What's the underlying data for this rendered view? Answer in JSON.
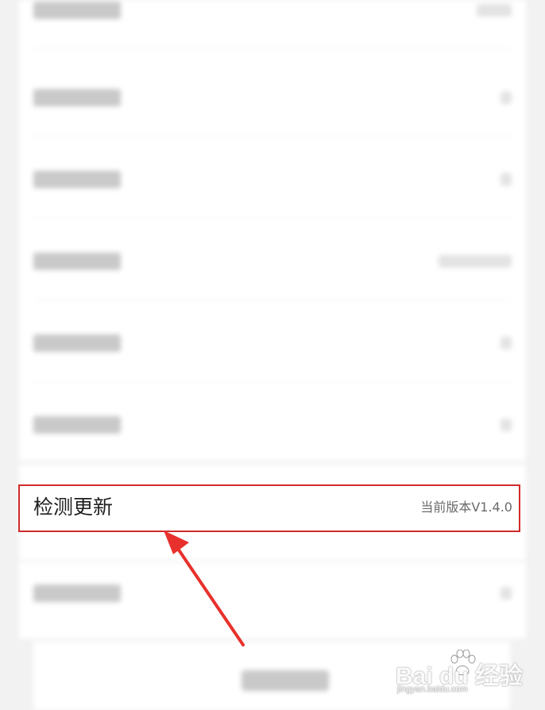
{
  "update_row": {
    "title": "检测更新",
    "version": "当前版本V1.4.0"
  },
  "watermark": {
    "logo": "Bai du 经验",
    "url": "jingyan.baidu.com"
  },
  "colors": {
    "highlight_border": "#d12b2b",
    "arrow": "#e8312c",
    "background": "#f2f2f2",
    "row_background": "#ffffff"
  },
  "icons": [
    "pointer-arrow-icon",
    "baidu-paw-icon"
  ]
}
